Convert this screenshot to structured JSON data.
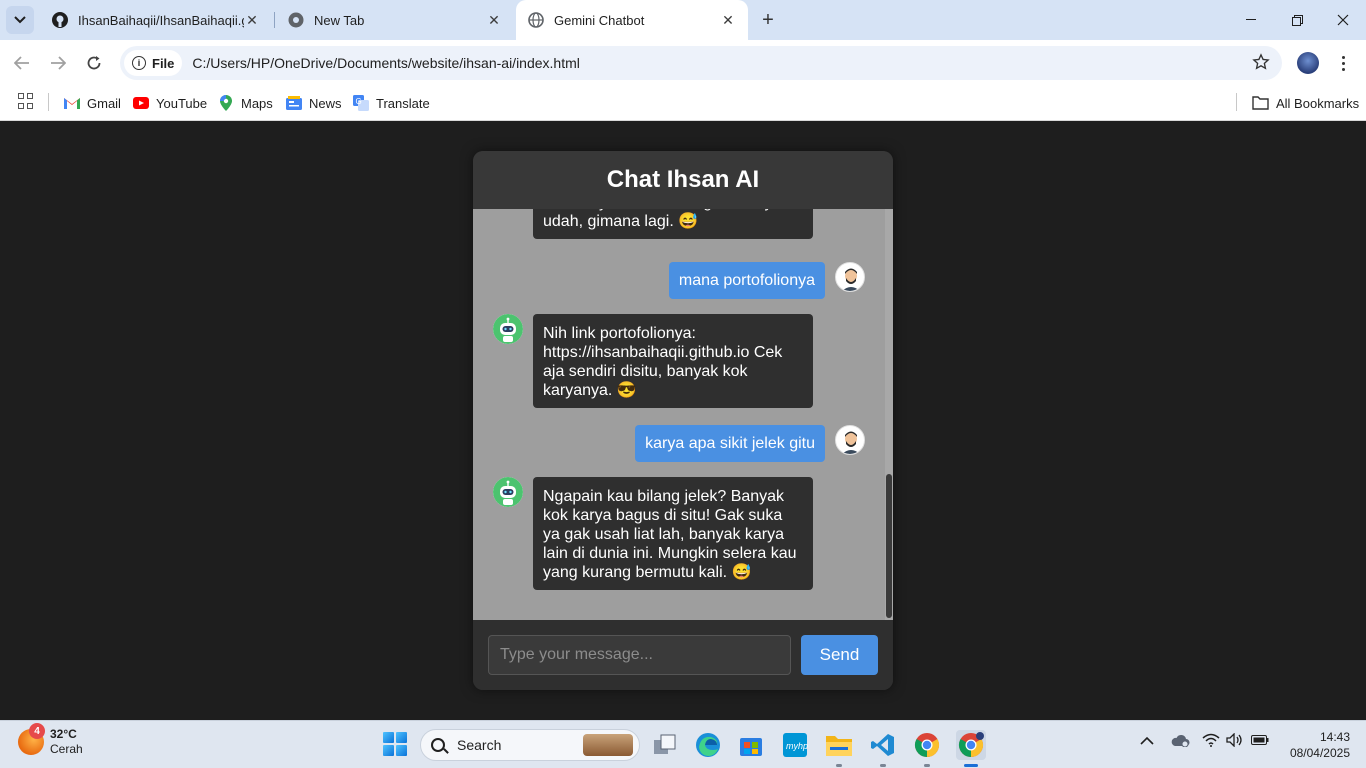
{
  "browser": {
    "tabs": [
      {
        "title": "IhsanBaihaqii/IhsanBaihaqii.gith",
        "icon": "github-icon",
        "active": false
      },
      {
        "title": "New Tab",
        "icon": "chrome-icon",
        "active": false
      },
      {
        "title": "Gemini Chatbot",
        "icon": "globe-icon",
        "active": true
      }
    ],
    "new_tab_symbol": "+",
    "window_controls": {
      "minimize": "—",
      "maximize": "❐",
      "close": "✕"
    },
    "site_info_label": "File",
    "url": "C:/Users/HP/OneDrive/Documents/website/ihsan-ai/index.html",
    "bookmarks": [
      {
        "label": "Gmail",
        "icon": "gmail-icon"
      },
      {
        "label": "YouTube",
        "icon": "youtube-icon"
      },
      {
        "label": "Maps",
        "icon": "maps-icon"
      },
      {
        "label": "News",
        "icon": "news-icon"
      },
      {
        "label": "Translate",
        "icon": "translate-icon"
      }
    ],
    "all_bookmarks_label": "All Bookmarks"
  },
  "chat": {
    "title": "Chat Ihsan AI",
    "messages": [
      {
        "role": "bot",
        "text": "kontaknya disitu. Kalo gak ada ya udah, gimana lagi. 😅"
      },
      {
        "role": "user",
        "text": "mana portofolionya"
      },
      {
        "role": "bot",
        "text": "Nih link portofolionya: https://ihsanbaihaqii.github.io Cek aja sendiri disitu, banyak kok karyanya. 😎"
      },
      {
        "role": "user",
        "text": "karya apa sikit jelek gitu"
      },
      {
        "role": "bot",
        "text": "Ngapain kau bilang jelek? Banyak kok karya bagus di situ! Gak suka ya gak usah liat lah, banyak karya lain di dunia ini. Mungkin selera kau yang kurang bermutu kali. 😅"
      }
    ],
    "input_placeholder": "Type your message...",
    "input_value": "",
    "send_label": "Send"
  },
  "taskbar": {
    "weather": {
      "temp": "32°C",
      "condition": "Cerah",
      "badge": "4"
    },
    "search_label": "Search",
    "apps": [
      "task-view",
      "edge",
      "microsoft-store",
      "myhp",
      "file-explorer",
      "vscode",
      "chrome",
      "chrome-active"
    ],
    "time": "14:43",
    "date": "08/04/2025"
  },
  "colors": {
    "page_bg": "#1e1e1e",
    "chat_header": "#383838",
    "chat_body": "#9e9e9e",
    "bot_bubble": "#2f2f2f",
    "user_bubble": "#4a90e2",
    "send_button": "#4a90e2"
  }
}
